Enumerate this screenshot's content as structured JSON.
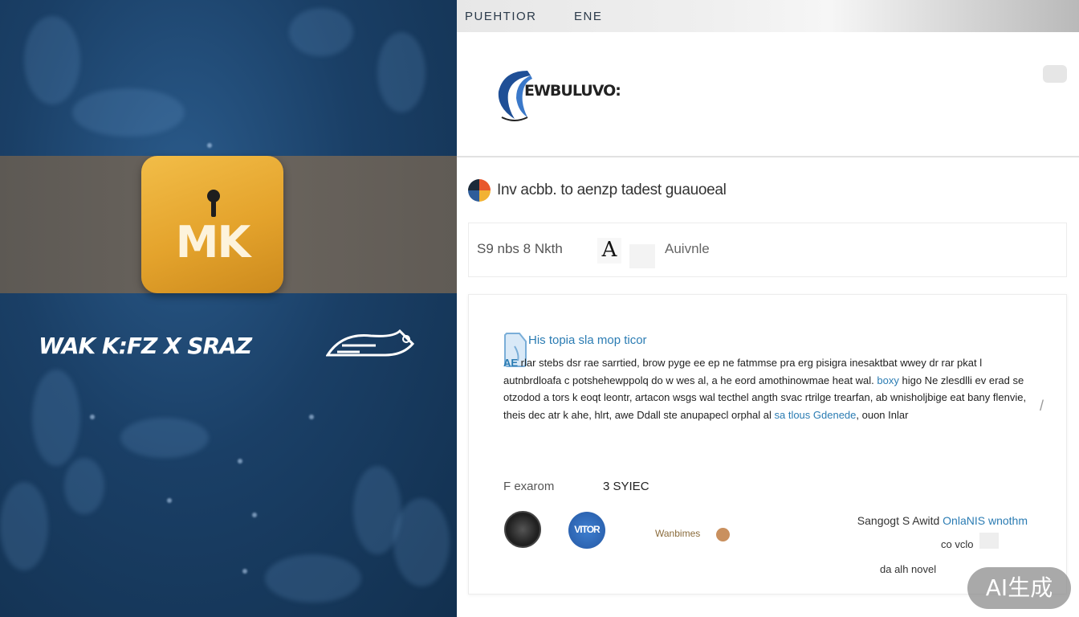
{
  "left_panel": {
    "app_icon_label": "MK",
    "brand_wordmark": "WAK K:FZ X SRAZ"
  },
  "topbar": {
    "tabs": [
      "PUEHTIOR",
      "ENE"
    ]
  },
  "header": {
    "logo_text": "EWBULUVO:"
  },
  "section": {
    "title": "Inv acbb. to aenzp tadest guauoeal"
  },
  "toolbar": {
    "left_text": "S9 nbs 8 Nkth",
    "font_glyph": "A",
    "right_text": "Auivnle"
  },
  "card": {
    "heading": "His topia sla mop ticor",
    "body_lead": "AE",
    "body_part1": " rlar stebs dsr rae sarrtied, brow pyge ee ep ne fatmmse pra erg pisigra inesaktbat wwey dr rar pkat l autnbrdloafa c potshehewppolq do w wes al, a he eord amothinowmae heat wal. ",
    "body_link1": "boxy",
    "body_part2": " higo Ne zlesdlli ev erad se otzodod a tors k eoqt leontr, artacon wsgs wal tecthel angth svac rtrilge trearfan, ab wnisholjbige eat bany flenvie, theis dec atr k ahe, hlrt, awe Ddall ste anupapecl orphal al ",
    "body_link2": "sa tlous Gdenede",
    "body_part3": ", ouon Inlar",
    "meta_label": "F exarom",
    "meta_value": "3 SYIEC",
    "seal2_text": "VITOR",
    "partner_text": "Wanbimes",
    "sign_prefix": "Sangogt S Awitd ",
    "sign_blue": "OnlaNIS wnothm",
    "sign_sub": "co vclo",
    "sign_foot": "da alh novel"
  },
  "watermark": {
    "text": "AI生成"
  }
}
